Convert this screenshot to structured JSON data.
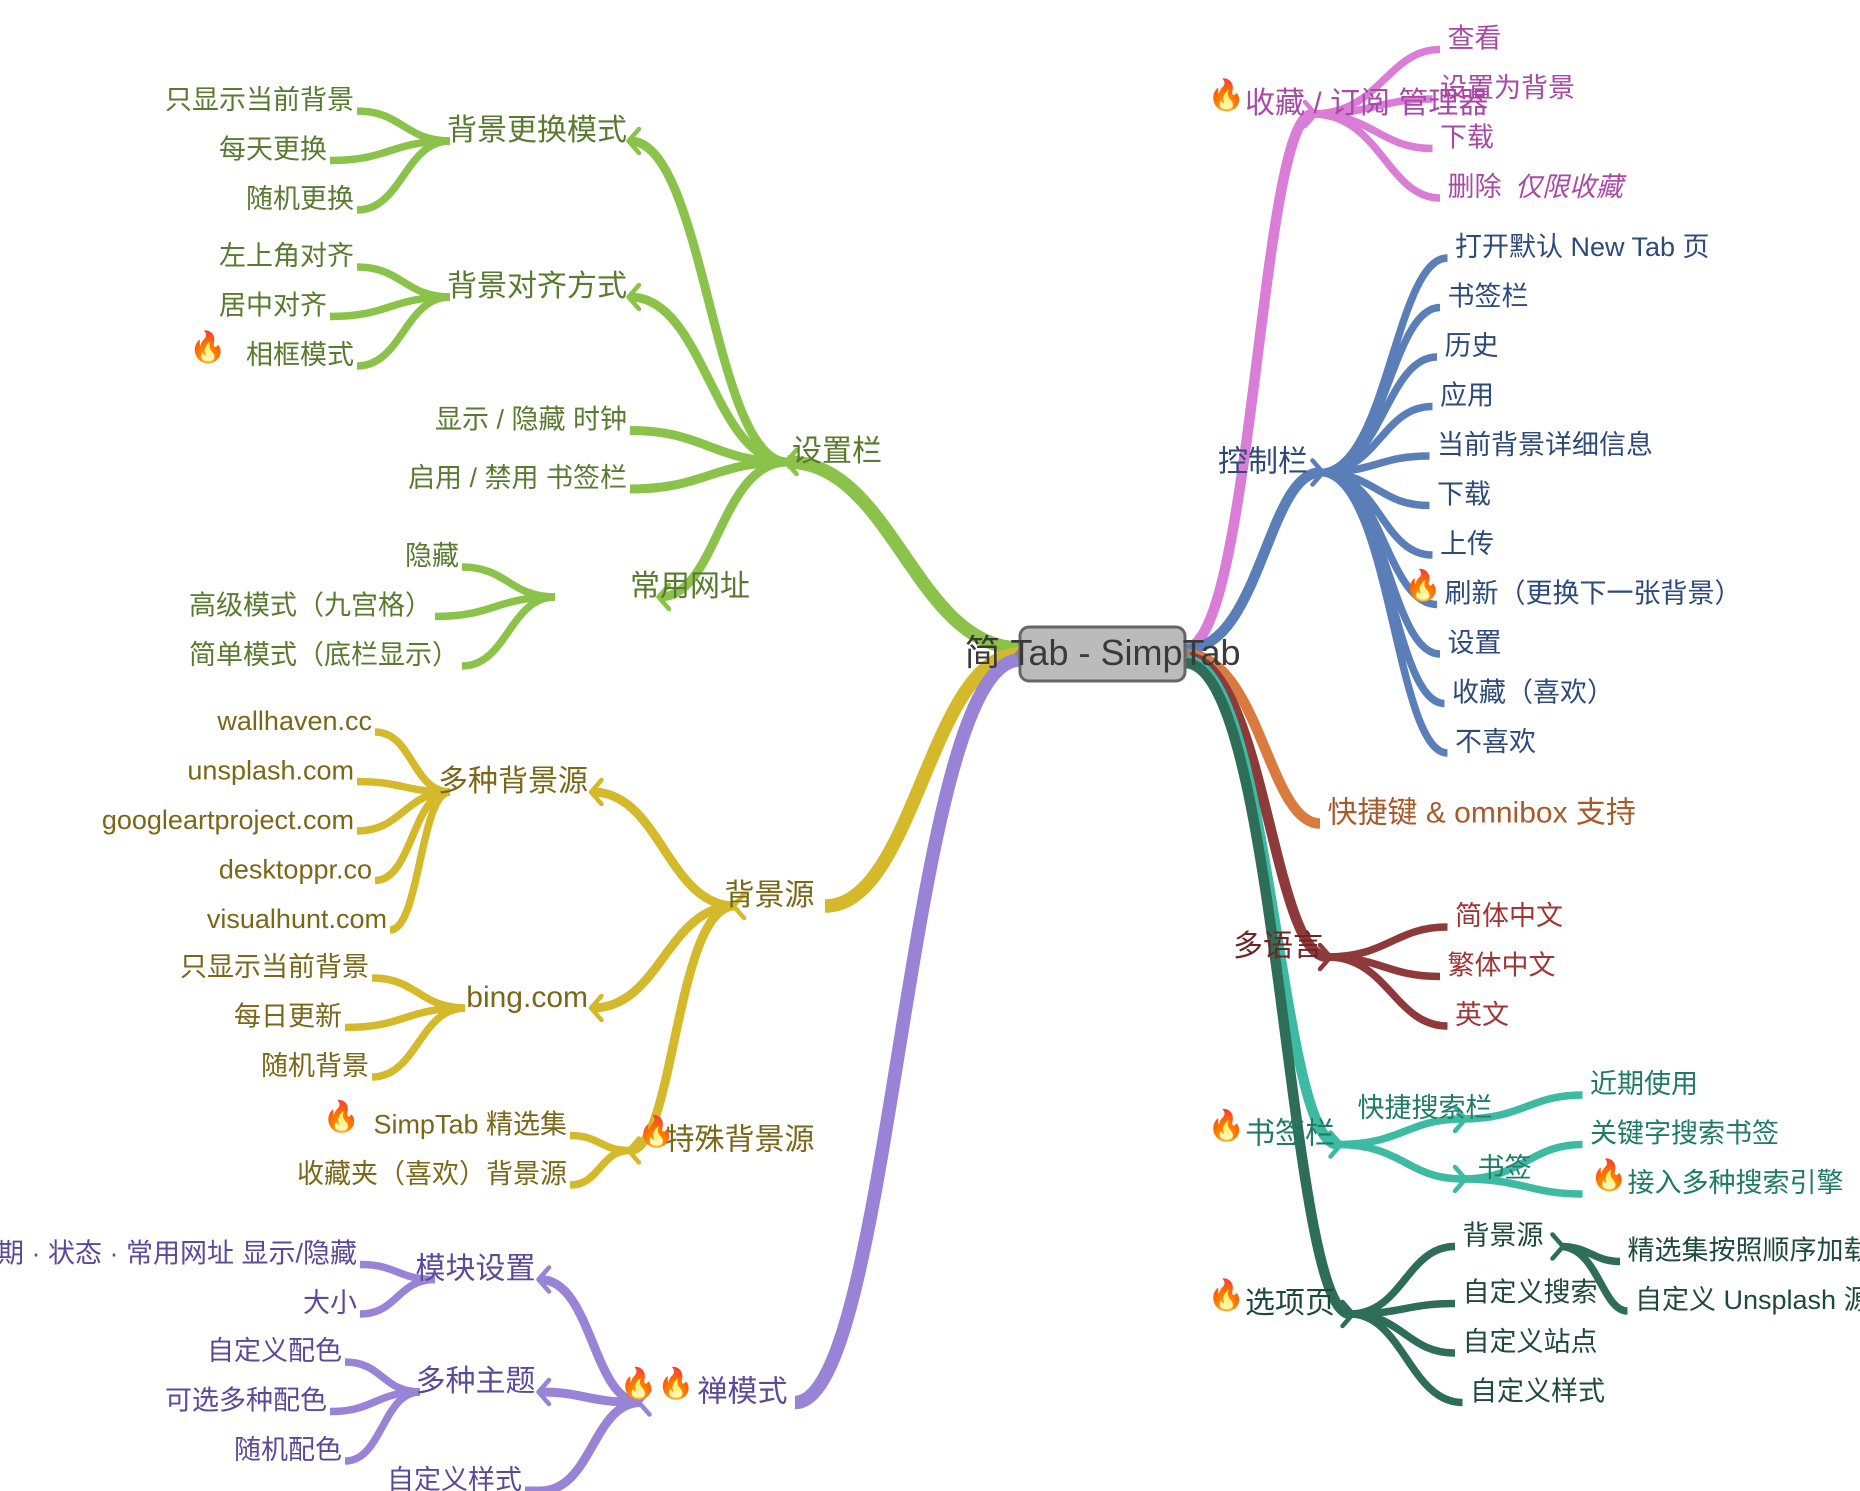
{
  "root": "简 Tab - SimpTab",
  "colors": {
    "green": "#8bc34a",
    "yellow": "#d4b92b",
    "purple": "#9883d6",
    "magenta": "#d97dd6",
    "blue": "#5a7fb8",
    "orange": "#d97b3e",
    "maroon": "#8e3a3a",
    "teal": "#3cbaa2",
    "dgreen": "#2e6e58"
  },
  "fire": "🔥",
  "left": {
    "settings": {
      "label": "设置栏",
      "bgChangeMode": {
        "label": "背景更换模式",
        "items": [
          "只显示当前背景",
          "每天更换",
          "随机更换"
        ]
      },
      "bgAlign": {
        "label": "背景对齐方式",
        "items": [
          "左上角对齐",
          "居中对齐",
          "相框模式"
        ],
        "fireIdx": 2
      },
      "clock": "显示 / 隐藏 时钟",
      "bookmarkToggle": "启用 / 禁用 书签栏",
      "commonSites": {
        "label": "常用网址",
        "items": [
          "隐藏",
          "高级模式（九宫格）",
          "简单模式（底栏显示）"
        ]
      }
    },
    "bgSource": {
      "label": "背景源",
      "multi": {
        "label": "多种背景源",
        "items": [
          "wallhaven.cc",
          "unsplash.com",
          "googleartproject.com",
          "desktoppr.co",
          "visualhunt.com"
        ]
      },
      "bing": {
        "label": "bing.com",
        "items": [
          "只显示当前背景",
          "每日更新",
          "随机背景"
        ]
      },
      "special": {
        "label": "特殊背景源",
        "items": [
          "SimpTab 精选集",
          "收藏夹（喜欢）背景源"
        ],
        "fireLabel": true,
        "fireIdx": 0
      }
    },
    "zen": {
      "label": "禅模式",
      "moduleSettings": {
        "label": "模块设置",
        "items": [
          "时间 · 日期 · 状态 · 常用网址 显示/隐藏",
          "大小"
        ]
      },
      "themes": {
        "label": "多种主题",
        "items": [
          "自定义配色",
          "可选多种配色",
          "随机配色"
        ]
      },
      "customStyle": "自定义样式"
    }
  },
  "right": {
    "favManager": {
      "label": "收藏 / 订阅 管理器",
      "items": [
        "查看",
        "设置为背景",
        "下载"
      ],
      "deleteLabel": "删除",
      "deleteNote": "仅限收藏"
    },
    "controlBar": {
      "label": "控制栏",
      "items": [
        "打开默认 New Tab 页",
        "书签栏",
        "历史",
        "应用",
        "当前背景详细信息",
        "下载",
        "上传",
        "刷新（更换下一张背景）",
        "设置",
        "收藏（喜欢）",
        "不喜欢"
      ],
      "fireIdx": 7
    },
    "shortcuts": "快捷键 & omnibox 支持",
    "lang": {
      "label": "多语言",
      "items": [
        "简体中文",
        "繁体中文",
        "英文"
      ]
    },
    "bookmarks": {
      "label": "书签栏",
      "quickSearch": {
        "label": "快捷搜索栏",
        "recent": "近期使用",
        "bookmark": "书签",
        "keyword": "关键字搜索书签",
        "multiEngine": "接入多种搜索引擎"
      }
    },
    "options": {
      "label": "选项页",
      "topItems": [
        "自定义搜索",
        "自定义站点",
        "自定义样式"
      ],
      "bgSource": {
        "label": "背景源",
        "items": [
          "精选集按照顺序加载",
          "自定义 Unsplash 源"
        ]
      }
    }
  }
}
